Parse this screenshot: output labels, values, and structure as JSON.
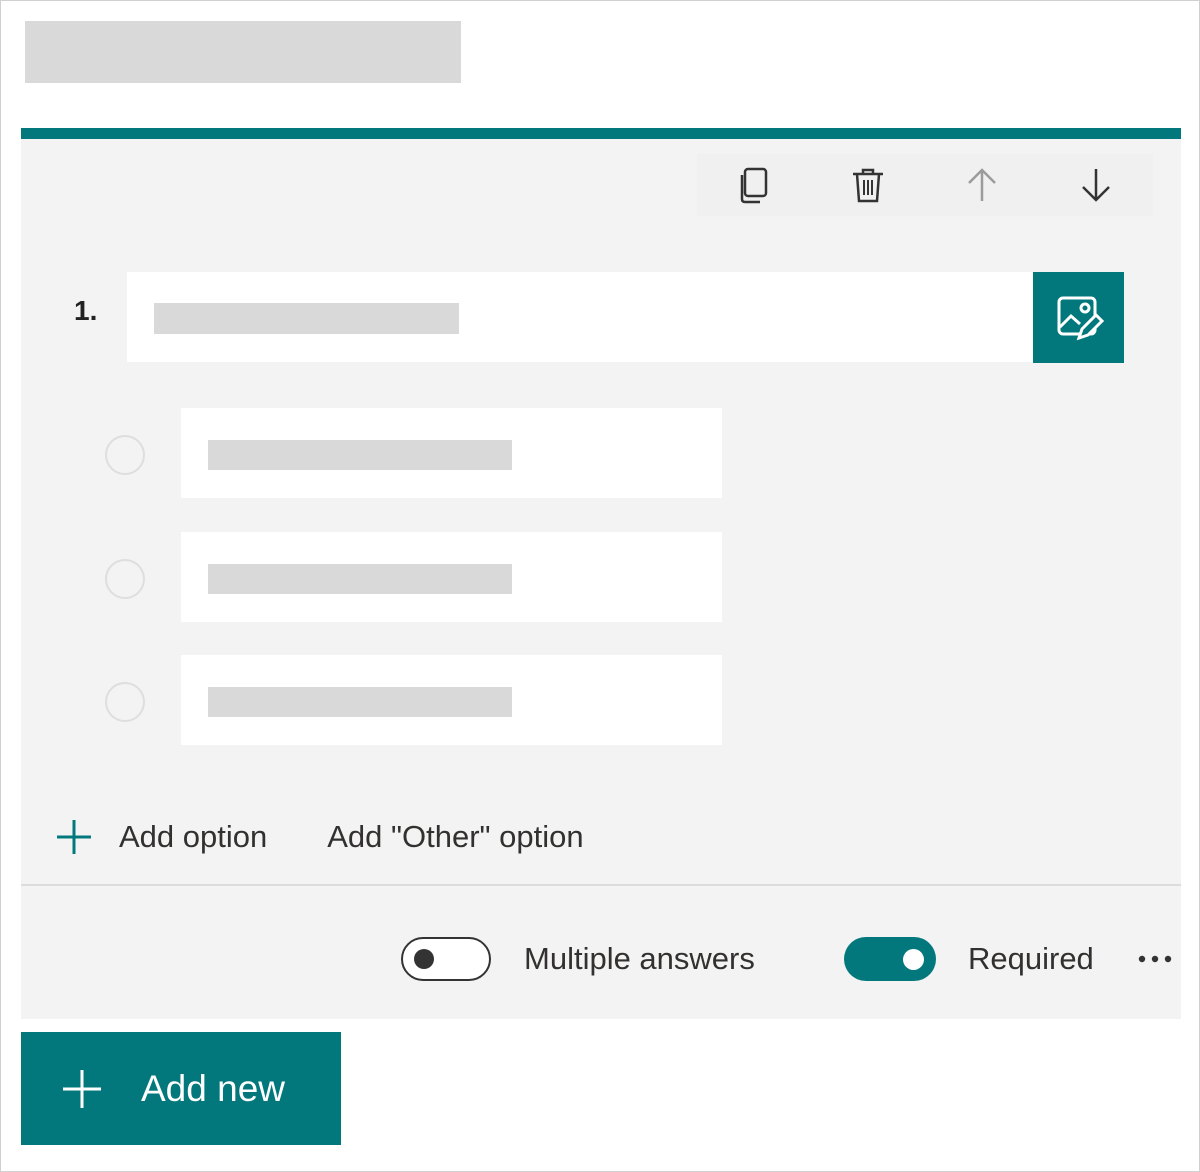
{
  "form": {
    "question_number": "1."
  },
  "toolbar": {
    "icons": [
      "copy-icon",
      "delete-icon",
      "move-up-icon",
      "move-down-icon"
    ]
  },
  "actions": {
    "add_option": "Add option",
    "add_other_option": "Add \"Other\" option"
  },
  "settings": {
    "multiple_answers_label": "Multiple answers",
    "multiple_answers_enabled": false,
    "required_label": "Required",
    "required_enabled": true
  },
  "footer": {
    "add_new_label": "Add new"
  },
  "colors": {
    "accent": "#03787c",
    "card_background": "#f3f3f3",
    "placeholder": "#d9d9d9"
  }
}
